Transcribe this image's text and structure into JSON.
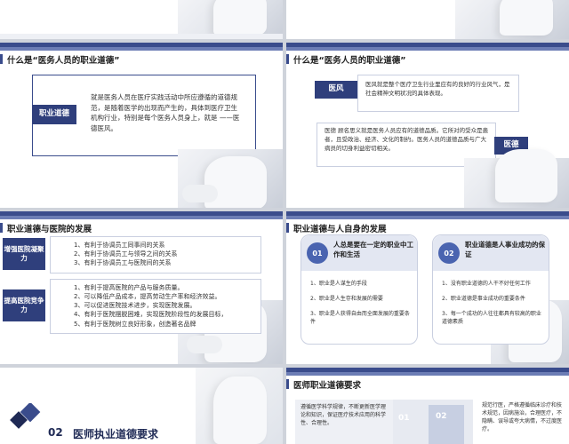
{
  "slide3": {
    "title": "什么是“医务人员的职业道德”",
    "label": "职业道德",
    "text": "就是医务人员在医疗实践活动中所应遵循的道德规范，是随着医学的出现而产生的，具体到医疗卫生机构行业，特别是每个医务人员身上，就是 ——医德医风。"
  },
  "slide4": {
    "title": "什么是“医务人员的职业道德”",
    "label1": "医风",
    "text1": "医风就是整个医疗卫生行业里应有的良好的行业风气，是社会精神文明状况的具体表现。",
    "label2": "医德",
    "text2": "医德  顾名思义就是医务人员应有的道德品质。它所对的受众是患者，且受政治、经济、文化的制约。医务人员的道德品质与广大病员的切身利益密切相关。"
  },
  "slide5": {
    "title": "职业道德与医院的发展",
    "label1": "增强医院凝聚力",
    "items1": [
      "1、有利于协调员工同事间的关系",
      "2、有利于协调员工与领导之间的关系",
      "3、有利于协调员工与医院间的关系"
    ],
    "label2": "提高医院竞争力",
    "items2": [
      "1、有利于提高医院的产品与服务质量。",
      "2、可以降低产品成本，提高劳动生产率和经济效益。",
      "3、可以促进医院技术进步，实现医院发展。",
      "4、有利于医院摆脱困难，实现医院阶段性的发展目标，",
      "5、有利于医院树立良好形象，创造著名品牌"
    ]
  },
  "slide6": {
    "title": "职业道德与人自身的发展",
    "num1": "01",
    "head1": "人总是要在一定的职业中工作和生活",
    "items1": [
      "1、职业是人谋生的手段",
      "2、职业是人生存和发展的需要",
      "3、职业是人获得自由而全面发展的重要条件"
    ],
    "num2": "02",
    "head2": "职业道德是人事业成功的保证",
    "items2": [
      "1、没有职业道德的人干不好任何工作",
      "2、职业道德是事业成功的重要条件",
      "3、每一个成功的人往往都具有较高的职业道德素质"
    ]
  },
  "slide7": {
    "number": "02",
    "title": "医师执业道德要求"
  },
  "slide8": {
    "title": "医师职业道德要求",
    "left_text": "遵循医学科学规律，不断更新医学理论和知识，保证医疗技术应用的科学性、合理性。",
    "num1": "01",
    "num2": "02",
    "right_text": "规范行医，严格遵循临床诊疗和技术规范，因病施治，合理医疗，不隐瞒、误导或夸大病情，不过度医疗。"
  }
}
